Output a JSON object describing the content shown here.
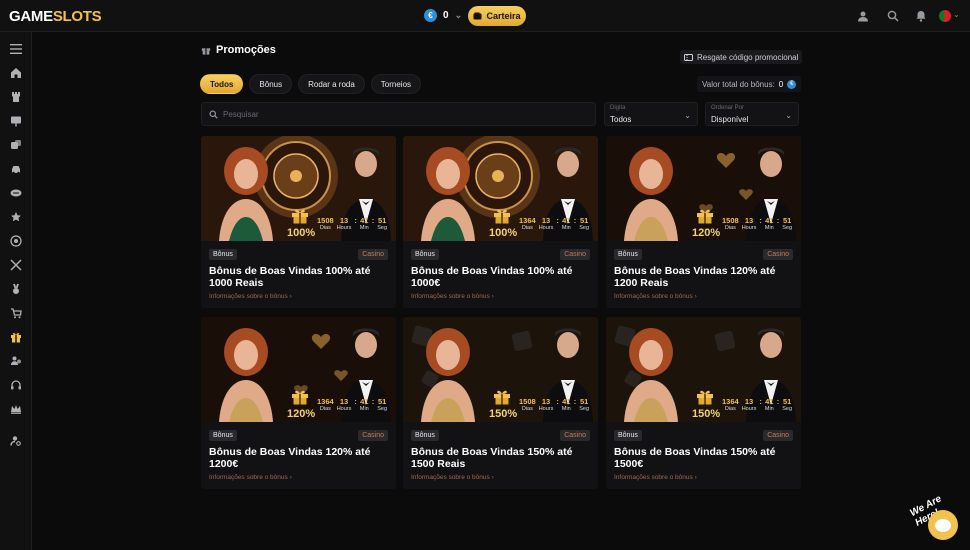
{
  "brand": {
    "logo_a": "GAME",
    "logo_b": "SLOTS"
  },
  "header": {
    "balance_amount": "0",
    "balance_currency": "€",
    "wallet_label": "Carteira",
    "accent": "#f2c14e"
  },
  "sidebar": {
    "items": [
      "menu-icon",
      "home-icon",
      "tower-icon",
      "presentation-icon",
      "dice-icon",
      "car-icon",
      "sport-icon",
      "star-icon",
      "target-icon",
      "swords-icon",
      "medal-icon",
      "cart-icon",
      "gift-icon",
      "users-icon",
      "headset-icon",
      "crown-icon",
      "user-search-icon"
    ]
  },
  "page": {
    "title": "Promoções",
    "promo_code_label": "Resgate código promocional",
    "tabs": [
      {
        "label": "Todos",
        "active": true
      },
      {
        "label": "Bônus",
        "active": false
      },
      {
        "label": "Rodar a roda",
        "active": false
      },
      {
        "label": "Torneios",
        "active": false
      }
    ],
    "total_bonus_label": "Valor total do bônus:",
    "total_bonus_value": "0",
    "search_placeholder": "Pesquisar",
    "filter_type": {
      "label": "Digita",
      "value": "Todos"
    },
    "filter_order": {
      "label": "Ordenar Por",
      "value": "Disponível"
    }
  },
  "timer_labels": {
    "days": "Dias",
    "hours": "Hours",
    "min": "Min",
    "sec": "Seg"
  },
  "cards": [
    {
      "tag_left": "Bônus",
      "tag_right": "Casino",
      "title": "Bônus de Boas Vindas 100% até 1000 Reais",
      "link": "Informações sobre o bônus",
      "days": "1508",
      "hours": "13",
      "min": "41",
      "sec": "51",
      "percent": "100%",
      "theme": "roulette"
    },
    {
      "tag_left": "Bônus",
      "tag_right": "Casino",
      "title": "Bônus de Boas Vindas 100% até 1000€",
      "link": "Informações sobre o bônus",
      "days": "1364",
      "hours": "13",
      "min": "41",
      "sec": "51",
      "percent": "100%",
      "theme": "roulette"
    },
    {
      "tag_left": "Bônus",
      "tag_right": "Casino",
      "title": "Bônus de Boas Vindas 120% até 1200 Reais",
      "link": "Informações sobre o bônus",
      "days": "1508",
      "hours": "13",
      "min": "41",
      "sec": "51",
      "percent": "120%",
      "theme": "hearts"
    },
    {
      "tag_left": "Bônus",
      "tag_right": "Casino",
      "title": "Bônus de Boas Vindas 120% até 1200€",
      "link": "Informações sobre o bônus",
      "days": "1364",
      "hours": "13",
      "min": "41",
      "sec": "51",
      "percent": "120%",
      "theme": "hearts"
    },
    {
      "tag_left": "Bônus",
      "tag_right": "Casino",
      "title": "Bônus de Boas Vindas 150% até 1500 Reais",
      "link": "Informações sobre o bônus",
      "days": "1508",
      "hours": "13",
      "min": "41",
      "sec": "51",
      "percent": "150%",
      "theme": "dice"
    },
    {
      "tag_left": "Bônus",
      "tag_right": "Casino",
      "title": "Bônus de Boas Vindas 150% até 1500€",
      "link": "Informações sobre o bônus",
      "days": "1364",
      "hours": "13",
      "min": "41",
      "sec": "51",
      "percent": "150%",
      "theme": "dice"
    }
  ],
  "chat": {
    "bubble_text": "We Are Here!"
  }
}
